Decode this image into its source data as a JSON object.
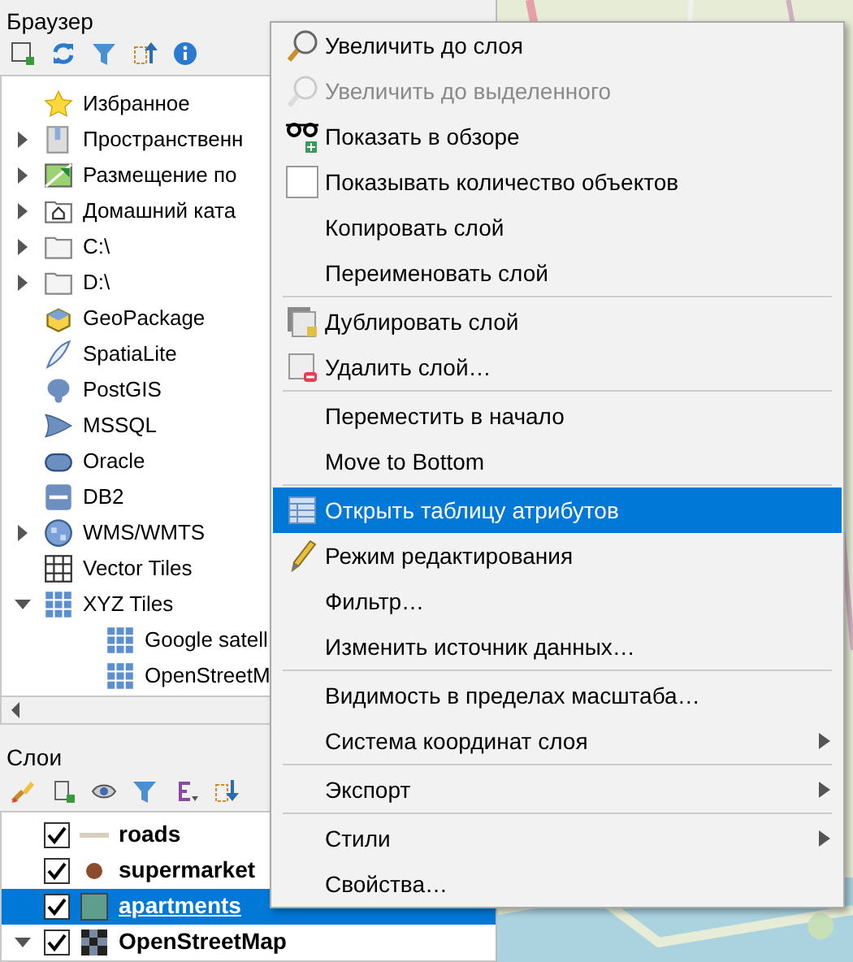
{
  "browser_panel": {
    "title": "Браузер",
    "tree": [
      {
        "label": "Избранное"
      },
      {
        "label": "Пространственн",
        "expanded": false
      },
      {
        "label": "Размещение по",
        "expanded": false
      },
      {
        "label": "Домашний ката",
        "expanded": false
      },
      {
        "label": "C:\\",
        "expanded": false
      },
      {
        "label": "D:\\",
        "expanded": false
      },
      {
        "label": "GeoPackage"
      },
      {
        "label": "SpatiaLite"
      },
      {
        "label": "PostGIS"
      },
      {
        "label": "MSSQL"
      },
      {
        "label": "Oracle"
      },
      {
        "label": "DB2"
      },
      {
        "label": "WMS/WMTS",
        "expanded": false
      },
      {
        "label": "Vector Tiles"
      },
      {
        "label": "XYZ Tiles",
        "expanded": true,
        "children": [
          {
            "label": "Google satell"
          },
          {
            "label": "OpenStreetM"
          }
        ]
      }
    ]
  },
  "layers_panel": {
    "title": "Слои",
    "layers": [
      {
        "label": "roads",
        "kind": "line",
        "color": "#d8d0bd",
        "checked": true,
        "selected": false
      },
      {
        "label": "supermarket",
        "kind": "point",
        "color": "#8c4b2c",
        "checked": true,
        "selected": false
      },
      {
        "label": "apartments",
        "kind": "polygon",
        "color": "#5f9e8c",
        "checked": true,
        "selected": true
      },
      {
        "label": "OpenStreetMap",
        "kind": "raster",
        "checked": true,
        "selected": false,
        "expanded": true
      }
    ]
  },
  "context_menu": {
    "groups": [
      [
        {
          "label": "Увеличить до слоя",
          "disabled": false,
          "selected": false
        },
        {
          "label": "Увеличить до выделенного",
          "disabled": true,
          "selected": false
        },
        {
          "label": "Показать в обзоре",
          "disabled": false,
          "selected": false
        },
        {
          "label": "Показывать количество объектов",
          "kind": "checkbox",
          "checked": false,
          "disabled": false,
          "selected": false
        },
        {
          "label": "Копировать слой",
          "disabled": false,
          "selected": false
        },
        {
          "label": "Переименовать слой",
          "disabled": false,
          "selected": false
        }
      ],
      [
        {
          "label": "Дублировать слой",
          "disabled": false,
          "selected": false
        },
        {
          "label": "Удалить слой…",
          "disabled": false,
          "selected": false
        }
      ],
      [
        {
          "label": "Переместить в начало",
          "disabled": false,
          "selected": false
        },
        {
          "label": "Move to Bottom",
          "disabled": false,
          "selected": false
        }
      ],
      [
        {
          "label": "Открыть таблицу атрибутов",
          "disabled": false,
          "selected": true
        },
        {
          "label": "Режим редактирования",
          "disabled": false,
          "selected": false
        },
        {
          "label": "Фильтр…",
          "disabled": false,
          "selected": false
        },
        {
          "label": "Изменить источник данных…",
          "disabled": false,
          "selected": false
        }
      ],
      [
        {
          "label": "Видимость в пределах масштаба…",
          "disabled": false,
          "selected": false
        },
        {
          "label": "Система координат слоя",
          "submenu": true,
          "disabled": false,
          "selected": false
        }
      ],
      [
        {
          "label": "Экспорт",
          "submenu": true,
          "disabled": false,
          "selected": false
        }
      ],
      [
        {
          "label": "Стили",
          "submenu": true,
          "disabled": false,
          "selected": false
        },
        {
          "label": "Свойства…",
          "disabled": false,
          "selected": false
        }
      ]
    ]
  }
}
